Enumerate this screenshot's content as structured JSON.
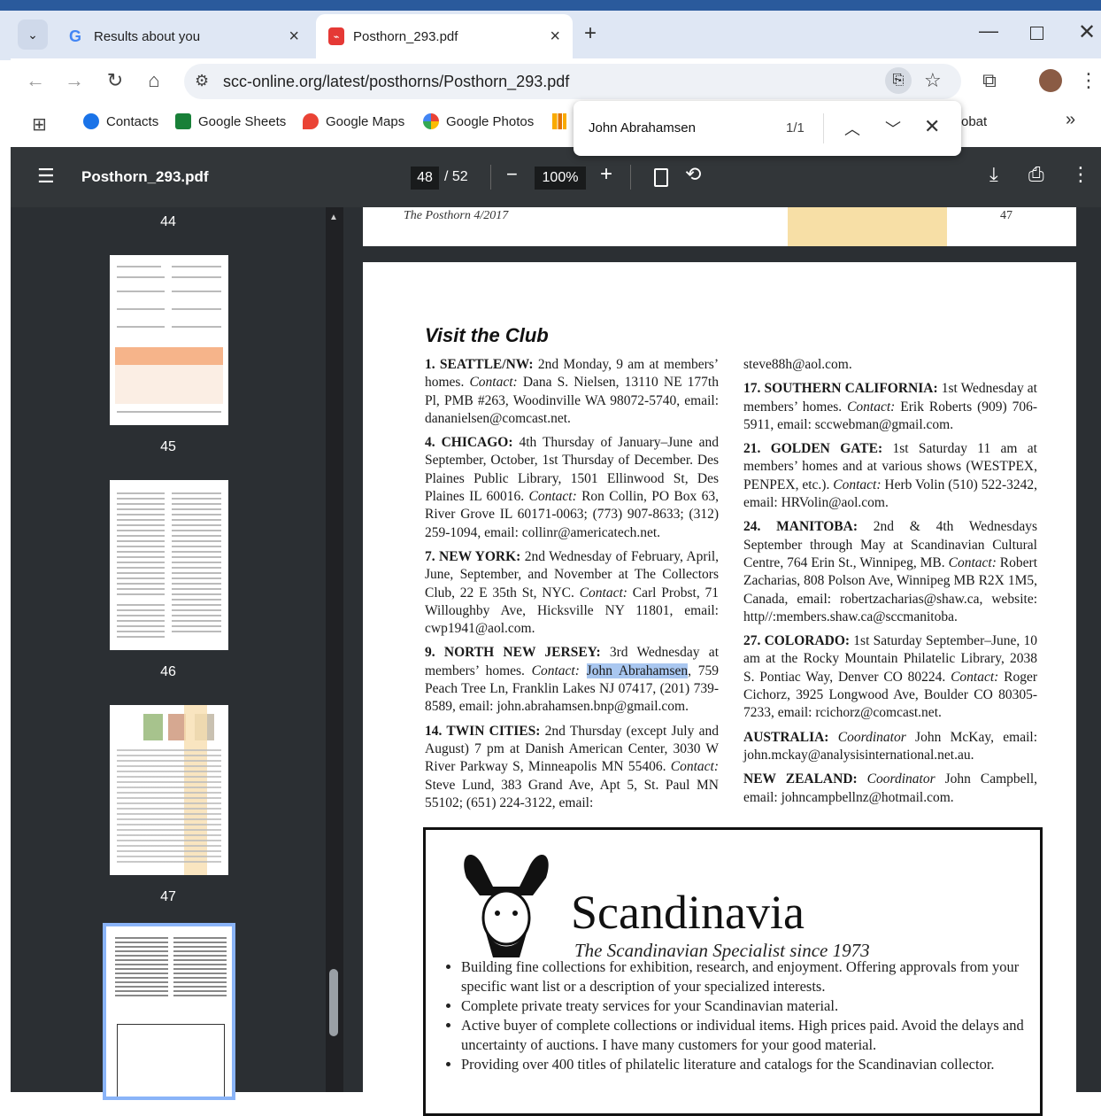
{
  "tabs": [
    {
      "title": "Results about you",
      "icon": "google-icon"
    },
    {
      "title": "Posthorn_293.pdf",
      "icon": "pdf-icon"
    }
  ],
  "toolbar": {
    "url": "scc-online.org/latest/posthorns/Posthorn_293.pdf"
  },
  "bookmarks": [
    {
      "label": "Contacts",
      "color": "#1a73e8"
    },
    {
      "label": "Google Sheets",
      "color": "#188038"
    },
    {
      "label": "Google Maps",
      "color": "#ea4335"
    },
    {
      "label": "Google Photos",
      "color": "#fbbc04"
    }
  ],
  "bookmark_partial": "obat",
  "find": {
    "query": "John Abrahamsen",
    "count": "1/1"
  },
  "pdf": {
    "filename": "Posthorn_293.pdf",
    "page": "48",
    "total": "/ 52",
    "zoom": "100%"
  },
  "sidebar": {
    "pages": [
      "44",
      "45",
      "46",
      "47"
    ]
  },
  "prev_page": {
    "footer_left": "The Posthorn 4/2017",
    "footer_right": "47"
  },
  "article": {
    "heading": "Visit the Club",
    "left": [
      {
        "title": "1. SEATTLE/NW:",
        "text": " 2nd Monday, 9 am at members’ homes. ",
        "contact_label": "Contact:",
        "rest": " Dana S. Nielsen, 13110 NE 177th Pl, PMB #263, Woodinville WA 98072-5740, email: dananielsen@comcast.net."
      },
      {
        "title": "4. CHICAGO:",
        "text": " 4th Thursday of January–June and September, October, 1st Thursday of December. Des Plaines Public Library, 1501 Ellinwood St, Des Plaines IL 60016. ",
        "contact_label": "Contact:",
        "rest": " Ron Collin, PO Box 63, River Grove IL 60171-0063; (773) 907-8633; (312) 259-1094, email: collinr@americatech.net."
      },
      {
        "title": "7. NEW YORK:",
        "text": " 2nd Wednesday of February, April, June, September, and November at The Collectors Club, 22 E 35th St, NYC. ",
        "contact_label": "Contact:",
        "rest": " Carl Probst, 71 Willoughby Ave, Hicksville NY 11801, email: cwp1941@aol.com."
      },
      {
        "title": "9. NORTH NEW JERSEY:",
        "text": " 3rd Wednesday at members’ homes. ",
        "contact_label": "Contact:",
        "highlight": "John Abrahamsen",
        "rest": ", 759 Peach Tree Ln, Franklin Lakes NJ 07417, (201) 739-8589, email: john.abrahamsen.bnp@gmail.com."
      },
      {
        "title": "14. TWIN CITIES:",
        "text": " 2nd Thursday (except July and August) 7 pm at Danish American Center, 3030 W River Parkway S, Minneapolis MN 55406. ",
        "contact_label": "Contact:",
        "rest": " Steve Lund, 383 Grand Ave, Apt 5, St. Paul MN 55102; (651) 224-3122, email:"
      }
    ],
    "right_top": "steve88h@aol.com.",
    "right": [
      {
        "title": "17. SOUTHERN CALIFORNIA:",
        "text": " 1st Wednesday at members’ homes. ",
        "contact_label": "Contact:",
        "rest": " Erik Roberts (909) 706-5911, email: sccwebman@gmail.com."
      },
      {
        "title": "21. GOLDEN GATE:",
        "text": " 1st Saturday 11 am at members’ homes and at various shows (WESTPEX, PENPEX, etc.). ",
        "contact_label": "Contact:",
        "rest": " Herb Volin (510) 522-3242, email: HRVolin@aol.com."
      },
      {
        "title": "24. MANITOBA:",
        "text": " 2nd & 4th Wednesdays September through May at Scandinavian Cultural Centre, 764 Erin St., Winnipeg, MB. ",
        "contact_label": "Contact:",
        "rest": " Robert Zacharias, 808 Polson Ave, Winnipeg MB R2X 1M5, Canada, email: robertzacharias@shaw.ca, website: http//:members.shaw.ca@sccmanitoba."
      },
      {
        "title": "27. COLORADO:",
        "text": " 1st Saturday September–June, 10 am at the Rocky Mountain Philatelic Library, 2038 S. Pontiac Way, Denver CO 80224. ",
        "contact_label": "Contact:",
        "rest": " Roger Cichorz, 3925 Longwood Ave, Boulder CO 80305-7233, email: rcichorz@comcast.net."
      },
      {
        "title": "AUSTRALIA:",
        "text": " ",
        "contact_label": "Coordinator",
        "rest": " John McKay, email: john.mckay@analysisinternational.net.au."
      },
      {
        "title": "NEW ZEALAND:",
        "text": " ",
        "contact_label": "Coordinator",
        "rest": " John Campbell, email: johncampbellnz@hotmail.com."
      }
    ]
  },
  "ad": {
    "title": "Scandinavia",
    "subtitle": "The Scandinavian Specialist since 1973",
    "bullets": [
      "Building fine collections for exhibition, research, and enjoyment. Offering approvals from your specific want list or a description of your specialized interests.",
      "Complete private treaty services for your Scandinavian material.",
      "Active buyer of complete collections or individual items. High prices paid. Avoid the delays and uncertainty of auctions. I have many customers for your good material.",
      "Providing over 400 titles of philatelic literature and catalogs for the Scandinavian collector."
    ]
  }
}
